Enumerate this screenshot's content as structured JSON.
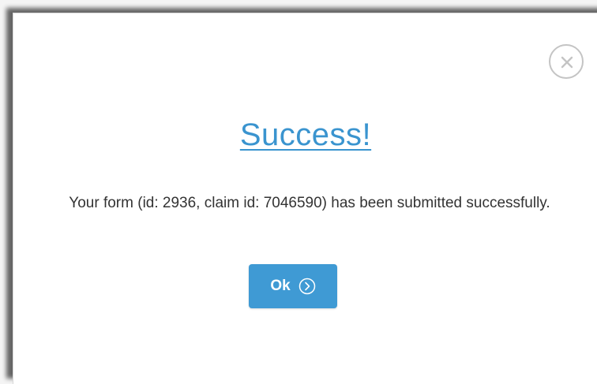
{
  "dialog": {
    "title": "Success!",
    "message": "Your form (id: 2936, claim id: 7046590) has been submitted successfully.",
    "ok_label": "Ok",
    "close_icon": "close-icon",
    "ok_icon": "chevron-right-circle-icon",
    "accent_color": "#3f9ad4"
  }
}
